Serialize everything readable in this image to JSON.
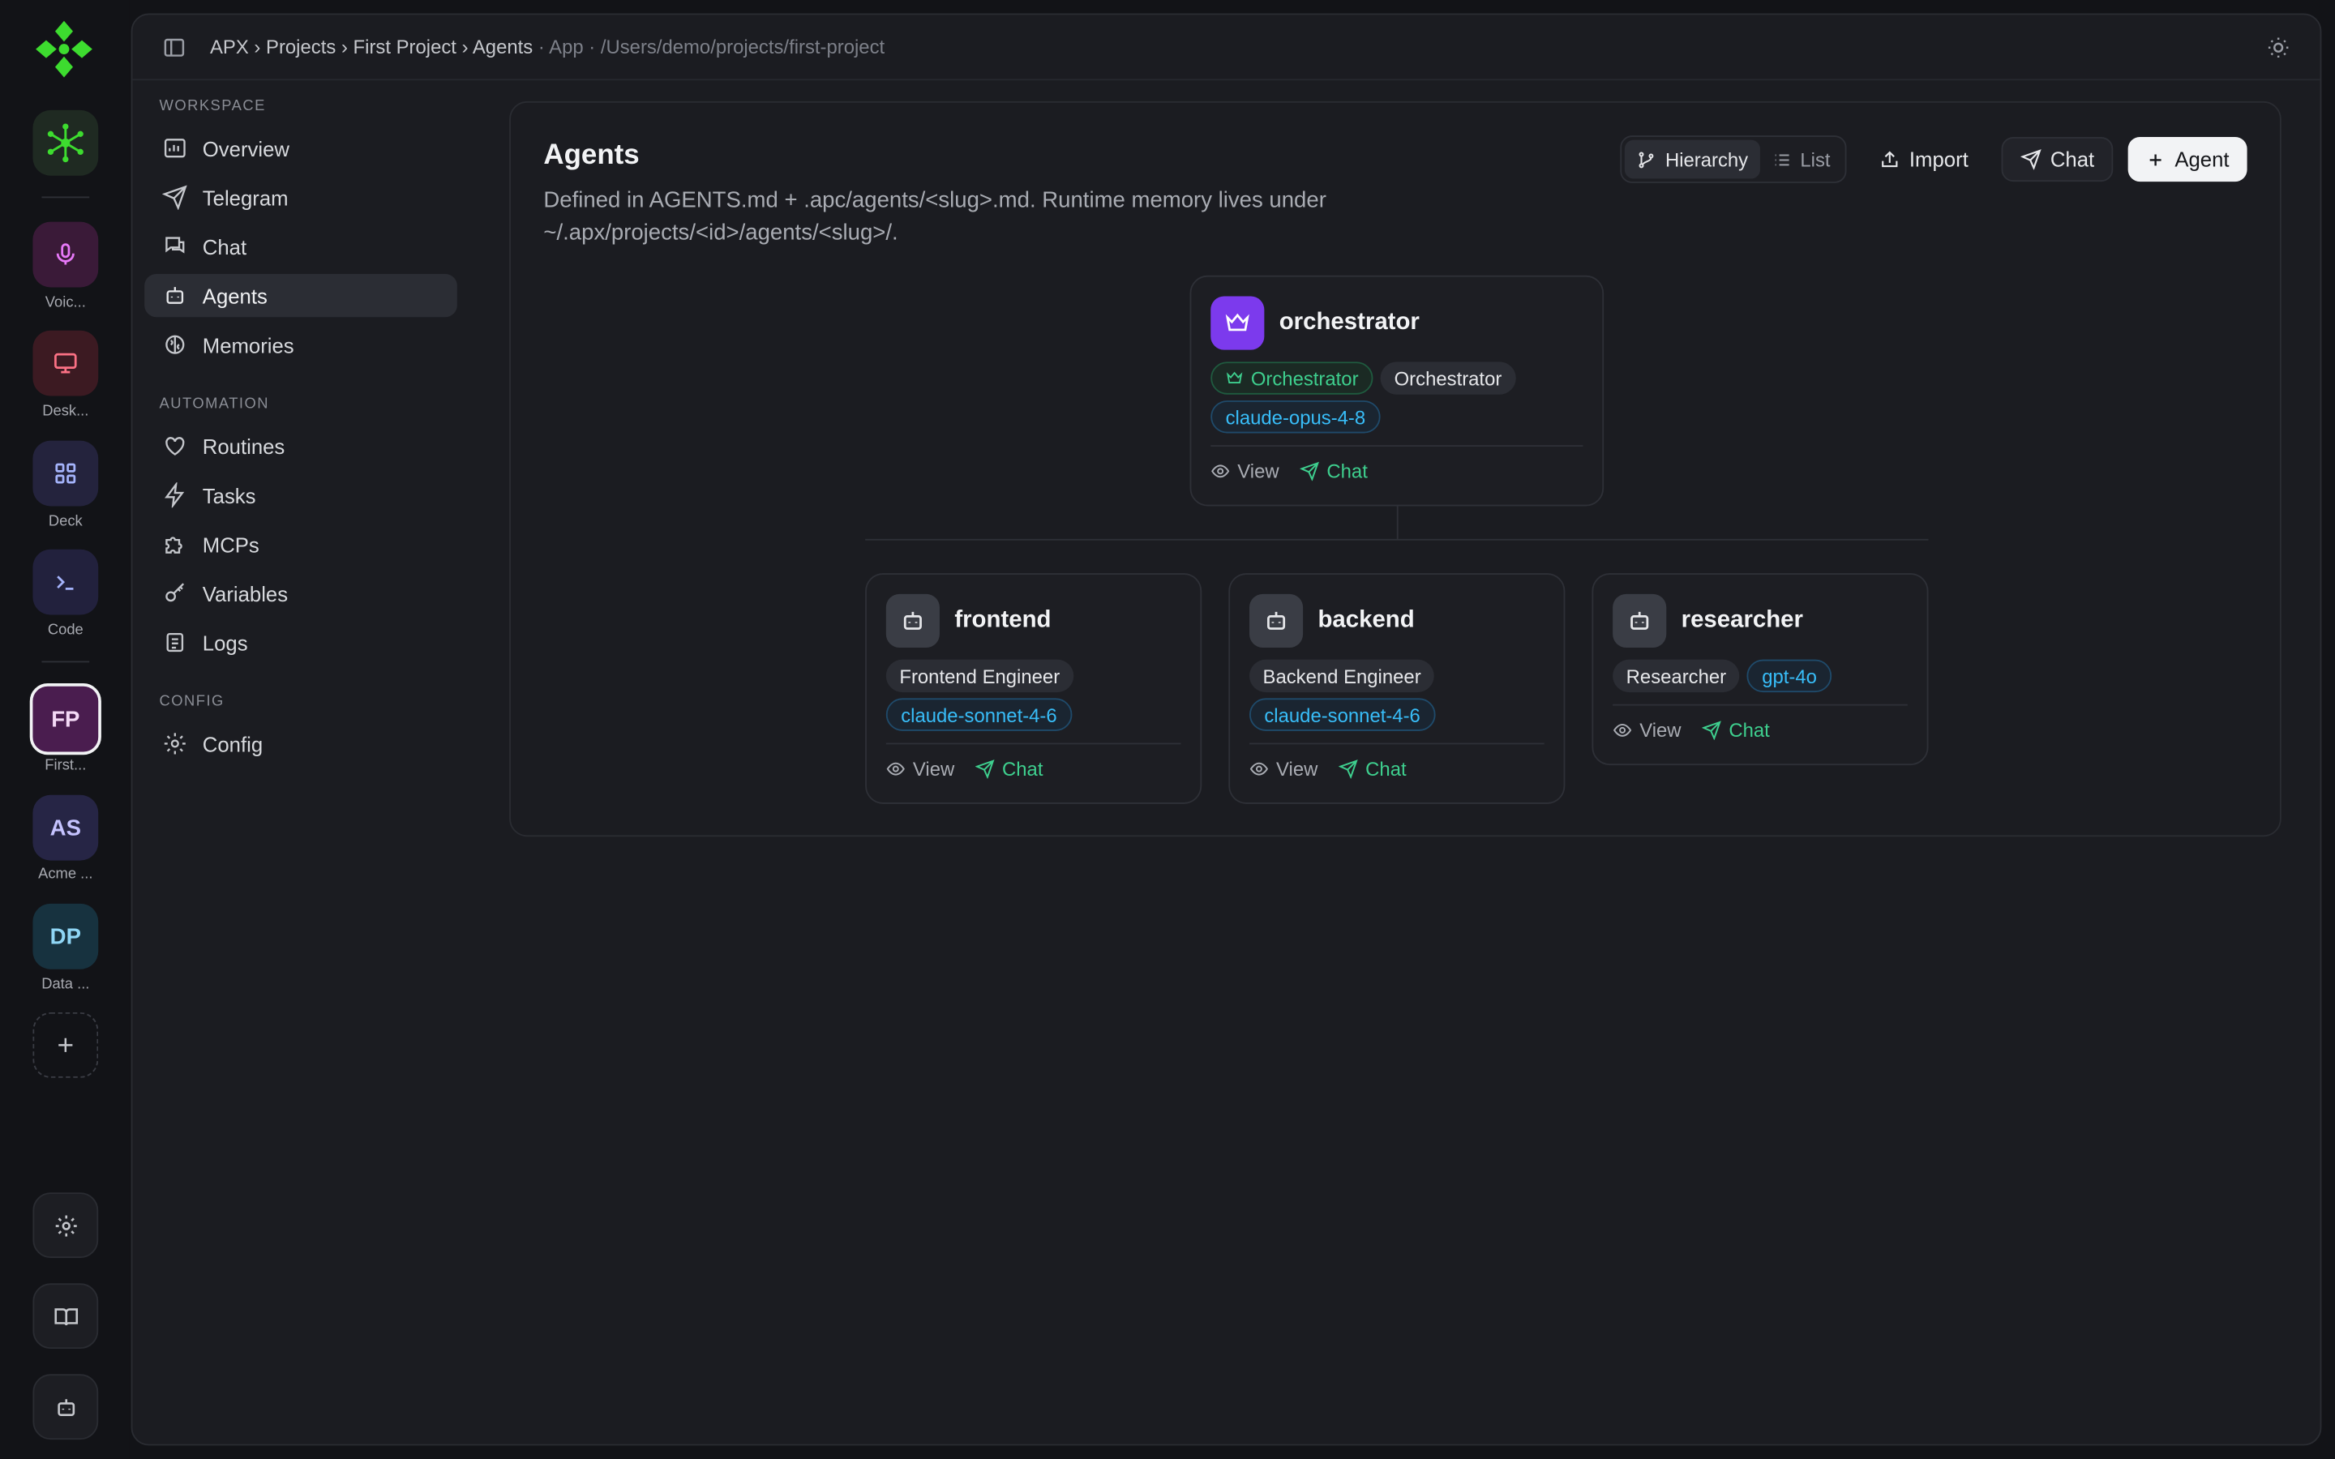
{
  "rail": {
    "items": [
      {
        "label": "Voic...",
        "icon": "microphone-icon"
      },
      {
        "label": "Desk...",
        "icon": "monitor-icon"
      },
      {
        "label": "Deck",
        "icon": "grid-icon"
      },
      {
        "label": "Code",
        "icon": "terminal-icon"
      }
    ],
    "projects": [
      {
        "initials": "FP",
        "label": "First...",
        "color": "#4a1d4f",
        "text": "#f4d9f6"
      },
      {
        "initials": "AS",
        "label": "Acme ...",
        "color": "#262545",
        "text": "#c5c3ff"
      },
      {
        "initials": "DP",
        "label": "Data ...",
        "color": "#17323f",
        "text": "#8fd6f5"
      }
    ]
  },
  "breadcrumb": {
    "apx": "APX",
    "projects": "Projects",
    "project": "First Project",
    "page": "Agents",
    "suffix": "· App · /Users/demo/projects/first-project"
  },
  "nav": {
    "workspace_label": "WORKSPACE",
    "workspace": [
      "Overview",
      "Telegram",
      "Chat",
      "Agents",
      "Memories"
    ],
    "automation_label": "AUTOMATION",
    "automation": [
      "Routines",
      "Tasks",
      "MCPs",
      "Variables",
      "Logs"
    ],
    "config_label": "CONFIG",
    "config": [
      "Config"
    ]
  },
  "page": {
    "title": "Agents",
    "description": "Defined in AGENTS.md + .apc/agents/<slug>.md. Runtime memory lives under ~/.apx/projects/<id>/agents/<slug>/."
  },
  "toolbar": {
    "hierarchy": "Hierarchy",
    "list": "List",
    "import": "Import",
    "chat": "Chat",
    "agent": "Agent"
  },
  "agents": {
    "orchestrator": {
      "name": "orchestrator",
      "badge": "Orchestrator",
      "role": "Orchestrator",
      "model": "claude-opus-4-8"
    },
    "frontend": {
      "name": "frontend",
      "role": "Frontend Engineer",
      "model": "claude-sonnet-4-6"
    },
    "backend": {
      "name": "backend",
      "role": "Backend Engineer",
      "model": "claude-sonnet-4-6"
    },
    "researcher": {
      "name": "researcher",
      "role": "Researcher",
      "model": "gpt-4o"
    }
  },
  "actions": {
    "view": "View",
    "chat": "Chat"
  },
  "colors": {
    "accent_green": "#3ecf8e",
    "model_blue": "#38bdf8",
    "orchestrator_purple": "#7c3aed",
    "logo_green": "#3ddc2f"
  }
}
